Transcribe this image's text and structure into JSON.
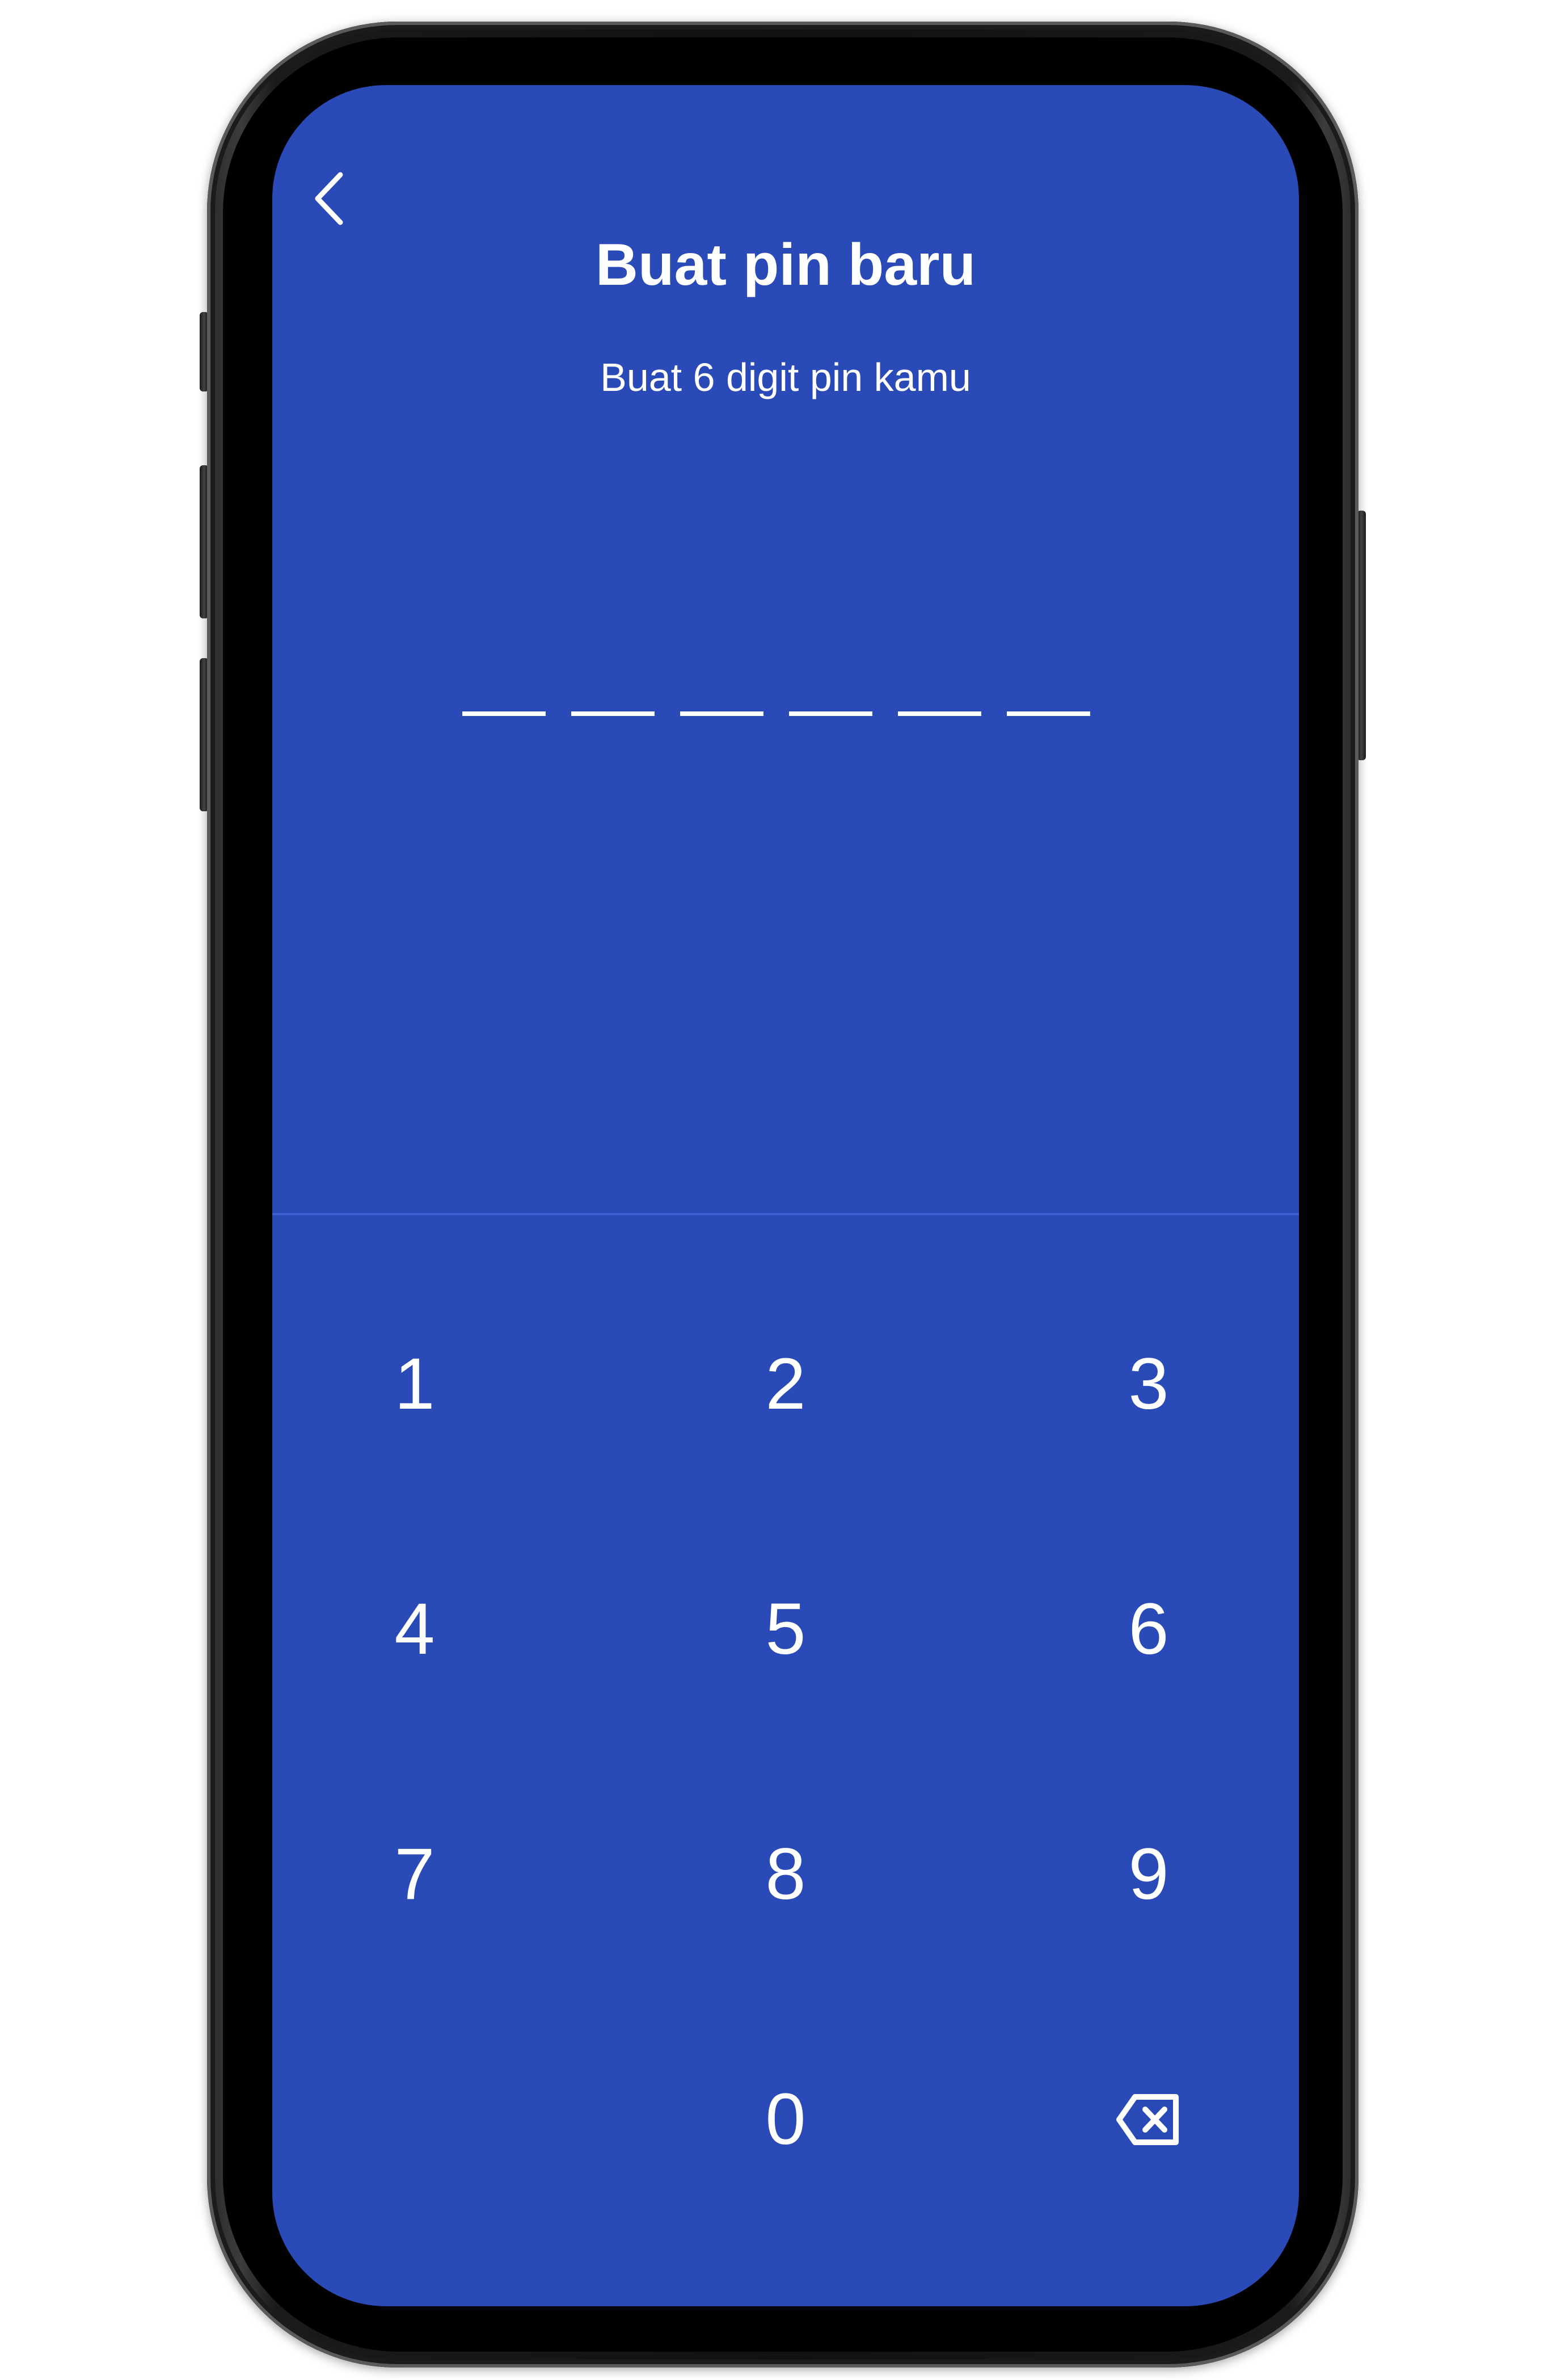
{
  "header": {
    "title": "Buat pin baru",
    "subtitle": "Buat 6 digit pin kamu",
    "back_icon": "chevron-left-icon"
  },
  "pin": {
    "length": 6,
    "entered": 0
  },
  "keypad": {
    "keys": [
      "1",
      "2",
      "3",
      "4",
      "5",
      "6",
      "7",
      "8",
      "9",
      "",
      "0"
    ],
    "delete_icon": "backspace-icon"
  },
  "colors": {
    "screen_background": "#2A4AB8",
    "text": "#FFFFFF",
    "divider": "#3C60D0"
  }
}
